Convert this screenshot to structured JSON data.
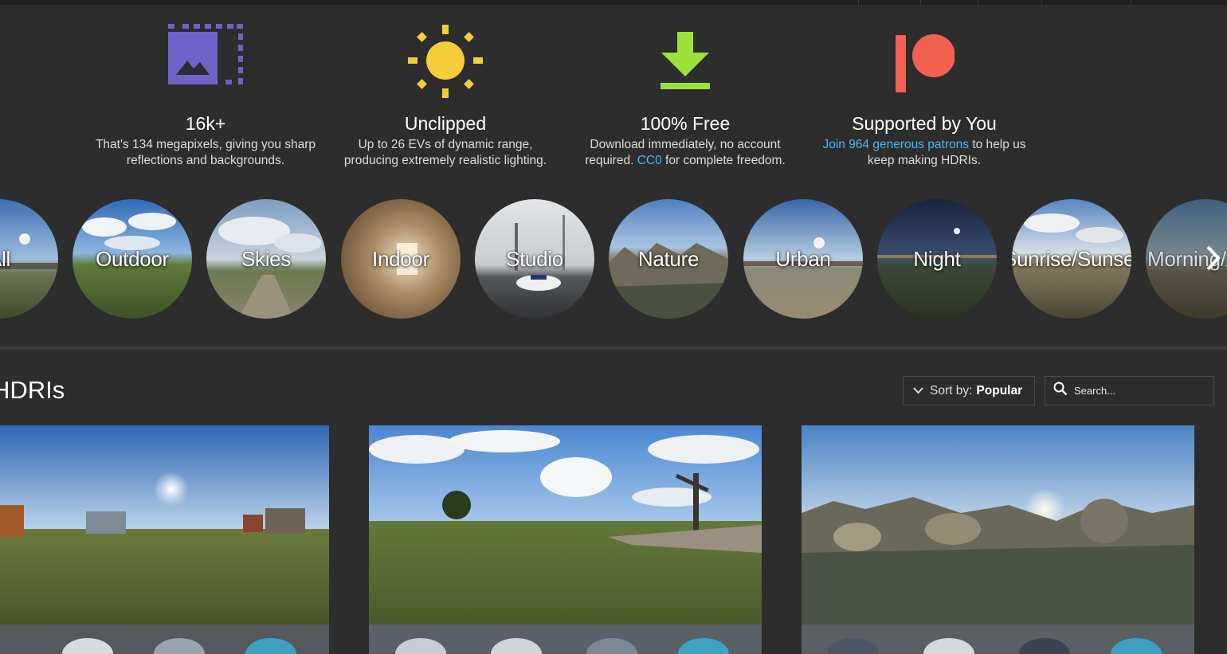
{
  "features": [
    {
      "icon": "image-resolution-icon",
      "title": "16k+",
      "desc_line1": "That's 134 megapixels, giving you sharp",
      "desc_line2": "reflections and backgrounds."
    },
    {
      "icon": "sun-icon",
      "title": "Unclipped",
      "desc_line1": "Up to 26 EVs of dynamic range,",
      "desc_line2": "producing extremely realistic lighting."
    },
    {
      "icon": "download-icon",
      "title": "100% Free",
      "desc_line1": "Download immediately, no account",
      "desc_line2_pre": "required. ",
      "desc_link": "CC0",
      "desc_line2_post": " for complete freedom."
    },
    {
      "icon": "patreon-icon",
      "title": "Supported by You",
      "desc_link": "Join 964 generous patrons",
      "desc_line1_post": " to help us",
      "desc_line2": "keep making HDRIs."
    }
  ],
  "categories": [
    {
      "label": "All"
    },
    {
      "label": "Outdoor"
    },
    {
      "label": "Skies"
    },
    {
      "label": "Indoor"
    },
    {
      "label": "Studio"
    },
    {
      "label": "Nature"
    },
    {
      "label": "Urban"
    },
    {
      "label": "Night"
    },
    {
      "label": "Sunrise/Sunset"
    },
    {
      "label": "Morning/Afternoon"
    }
  ],
  "section_heading": "HDRIs",
  "sort": {
    "label": "Sort by:",
    "value": "Popular"
  },
  "search": {
    "placeholder": "Search..."
  },
  "colors": {
    "background": "#2d2d2d",
    "link": "#4bb6f0",
    "icon_purple": "#6f63c9",
    "icon_yellow": "#f5cd3a",
    "icon_green": "#9ee03a",
    "icon_red": "#f26050"
  }
}
